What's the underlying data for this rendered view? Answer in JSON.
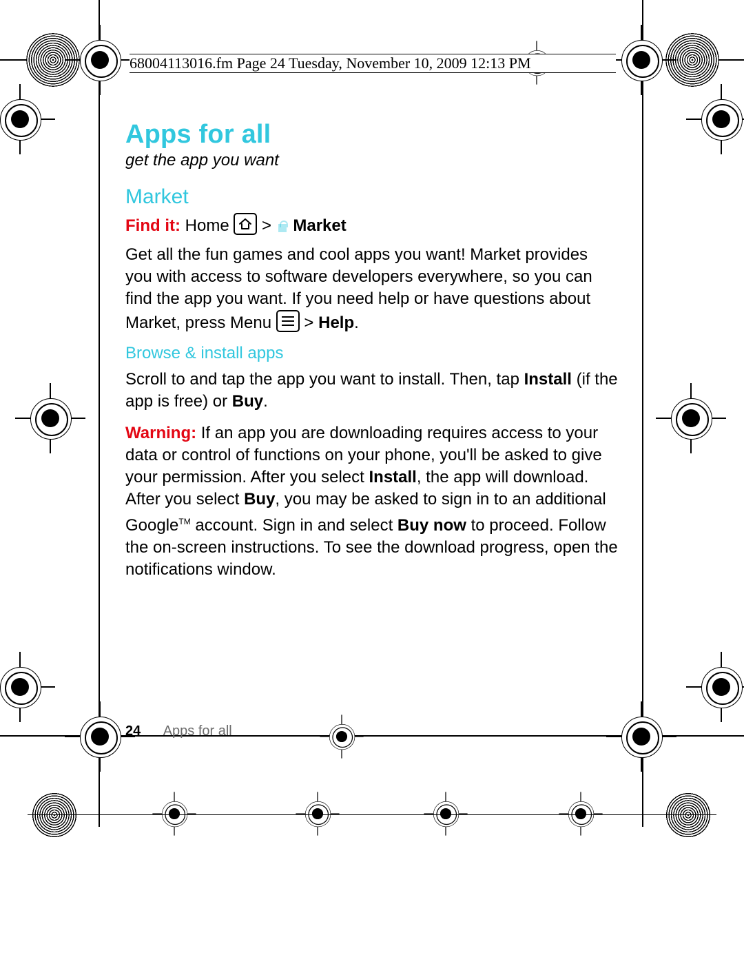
{
  "slug": "68004113016.fm  Page 24  Tuesday, November 10, 2009  12:13 PM",
  "title": "Apps for all",
  "subtitle": "get the app you want",
  "market_heading": "Market",
  "find_it_label": "Find it:",
  "find_it_home": "Home",
  "find_it_separator": ">",
  "find_it_market": "Market",
  "intro_1": "Get all the fun games and cool apps you want! Market provides you with access to software developers everywhere, so you can find the app you want. If you need help or have questions about Market, press Menu ",
  "intro_2_sep": " > ",
  "intro_help": "Help",
  "intro_period": ".",
  "browse_heading": "Browse & install apps",
  "scroll_1": "Scroll to and tap the app you want to install. Then, tap ",
  "scroll_install": "Install",
  "scroll_2": " (if the app is free) or ",
  "scroll_buy": "Buy",
  "scroll_3": ".",
  "warn_label": "Warning:",
  "warn_1": " If an app you are downloading requires access to your data or control of functions on your phone, you'll be asked to give your permission. After you select ",
  "warn_install": "Install",
  "warn_2": ", the app will download. After you select ",
  "warn_buy": "Buy",
  "warn_3": ", you may be asked to sign in to an additional Google",
  "warn_tm": "TM",
  "warn_4": " account. Sign in and select ",
  "warn_buynow": "Buy now",
  "warn_5": " to proceed. Follow the on-screen instructions. To see the download progress, open the notifications window.",
  "footer_page": "24",
  "footer_section": "Apps for all"
}
